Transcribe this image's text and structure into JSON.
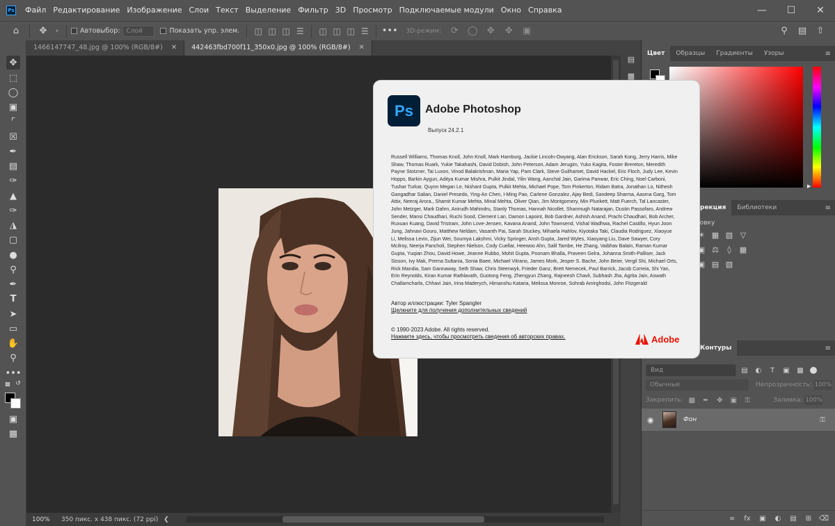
{
  "app": {
    "logo": "Ps",
    "menu": [
      "Файл",
      "Редактирование",
      "Изображение",
      "Слои",
      "Текст",
      "Выделение",
      "Фильтр",
      "3D",
      "Просмотр",
      "Подключаемые модули",
      "Окно",
      "Справка"
    ],
    "window_controls": [
      "minimize-icon",
      "maximize-icon",
      "close-icon"
    ]
  },
  "options": {
    "autoselect_label": "Автовыбор:",
    "autoselect_value": "Слой",
    "show_controls_label": "Показать упр. элем.",
    "mode3d_label": "3D-режим:"
  },
  "tabs": [
    {
      "label": "1466147747_48.jpg @ 100% (RGB/8#)",
      "active": false
    },
    {
      "label": "442463fbd700f11_350x0.jpg @ 100% (RGB/8#)",
      "active": true
    }
  ],
  "status": {
    "zoom": "100%",
    "doc_info": "350 пикс. x 438 пикс. (72 ppi)",
    "arrow": "❮"
  },
  "panels": {
    "color_tabs": [
      "Цвет",
      "Образцы",
      "Градиенты",
      "Узоры"
    ],
    "adjust_tabs": [
      "рекция",
      "Библиотеки"
    ],
    "adjust_label": "ровку",
    "layers_tabs": [
      "Контуры"
    ],
    "search_placeholder": "Вид",
    "blend_mode": "Обычные",
    "opacity_label": "Непрозрачность:",
    "opacity_value": "100%",
    "lock_label": "Закрепить:",
    "fill_label": "Заливка:",
    "fill_value": "100%",
    "layer_name": "Фон"
  },
  "about": {
    "logo": "Ps",
    "title": "Adobe Photoshop",
    "version": "Выпуск 24.2.1",
    "credits": "Russell Williams, Thomas Knoll, John Knoll, Mark Hamburg, Jackie Lincoln-Owyang, Alan Erickson, Sarah Kong, Jerry Harris, Mike Shaw, Thomas Ruark, Yukie Takahashi, David Dobish, John Peterson, Adam Jerugim, Yuko Kagita, Foster Brereton, Meredith Payne Stotzner, Tai Luxon, Vinod Balakrishnan, Maria Yap, Pam Clark, Steve Guilhamet, David Hackel, Eric Floch, Judy Lee, Kevin Hopps, Barkin Aygun, Aditya Kumar Mishra, Pulkit Jindal, Yilin Wang, Aanchal Jain, Garima Panwar, Eric Ching, Noel Carboni, Tushar Turkar, Quynn Megan Le, Nishant Gupta, Pulkit Mehta, Michael Pope, Tom Pinkerton, Ridam Batra, Jonathan Lo, Nithesh Gangadhar Salian, Daniel Presedo, Ying-An Chen, I-Ming Pao, Carlene Gonzalez, Ajay Bedi, Sandeep Sharma, Aasma Garg, Tom Attix, Neeraj Arora., Shamit Kumar Mehta, Minal Mehta, Oliver Qian, Jim Montgomery, Min Plunkett, Matt Fuerch, Tal Lancaster, John Metzger, Mark Dahm, Anirudh Mahindru, Stanly Thomas, Hannah Nicollet, Shanmugh Natarajan, Dustin Passofaro, Andrew Sender, Mansi Chaudhari, Ruchi Sood, Clement Lan, Damon Lapoint, Bob Gardner, Ashish Anand, Prachi Chaudhari, Bob Archer, Ruxuan Kuang, David Tristram, John Love-Jensen, Kavana Anand, John Townsend, Vishal Wadhwa, Rachel Castillo, Hyun Joon Jung, Jahnavi Gouru, Matthew Neldam, Vasanth Pai, Sarah Stuckey, Mihaela Hahlov, Kiyotaka Taki, Claudia Rodriguez, Xiaoyue Li, Melissa Levin, Zijun Wei, Soumya Lakshmi, Vicky Springer, Ansh Gupta, Jared Wyles, Xiaoyang Liu, Dave Sawyer, Cory McIlroy, Neerja Pancholi, Stephen Nielson, Cody Cuellar, Heewoo Ahn, Salil Tambe, He Zhang, Vaibhav Balain, Raman Kumar Gupta, Yuqian Zhou, David Howe, Jeanne Rubbo, Mohit Gupta, Poonam Bhalla, Praveen Gelra, Johanna Smith-Palliser, Jack Sisson, Ivy Mak, Prerna Sultania, Sonia Baee, Michael Vitrano, James Mork, Jesper S. Bache, John Beier, Vergil Shi, Michael Orts, Rick Mandia, Sam Gannaway, Seth Shaw, Chris Steenwyk, Frieder Ganz, Brett Nemecek, Paul Barrick, Jacob Correia, Shi Yan, Erin Reynolds, Kiran Kumar Rathlavath, Guotong Feng, Zhengyun Zhang, Rajneesh Chavli, Subhash Jha, Agrita Jain, Aswath Challamcharla, Chhavi Jain, Irina Maderych, Himanshu Kataria, Melissa Monroe, Sohrab Amirghodsi, John Fitzgerald",
    "illustration_author": "Автор иллюстрации: Tyler Spangler",
    "more_info_link": "Щелкните для получения дополнительных сведений",
    "copyright": "© 1990-2023 Adobe. All rights reserved.",
    "legal_link": "Нажмите здесь, чтобы просмотреть сведения об авторских правах.",
    "brand": "Adobe",
    "brand_color": "#eb1000"
  }
}
